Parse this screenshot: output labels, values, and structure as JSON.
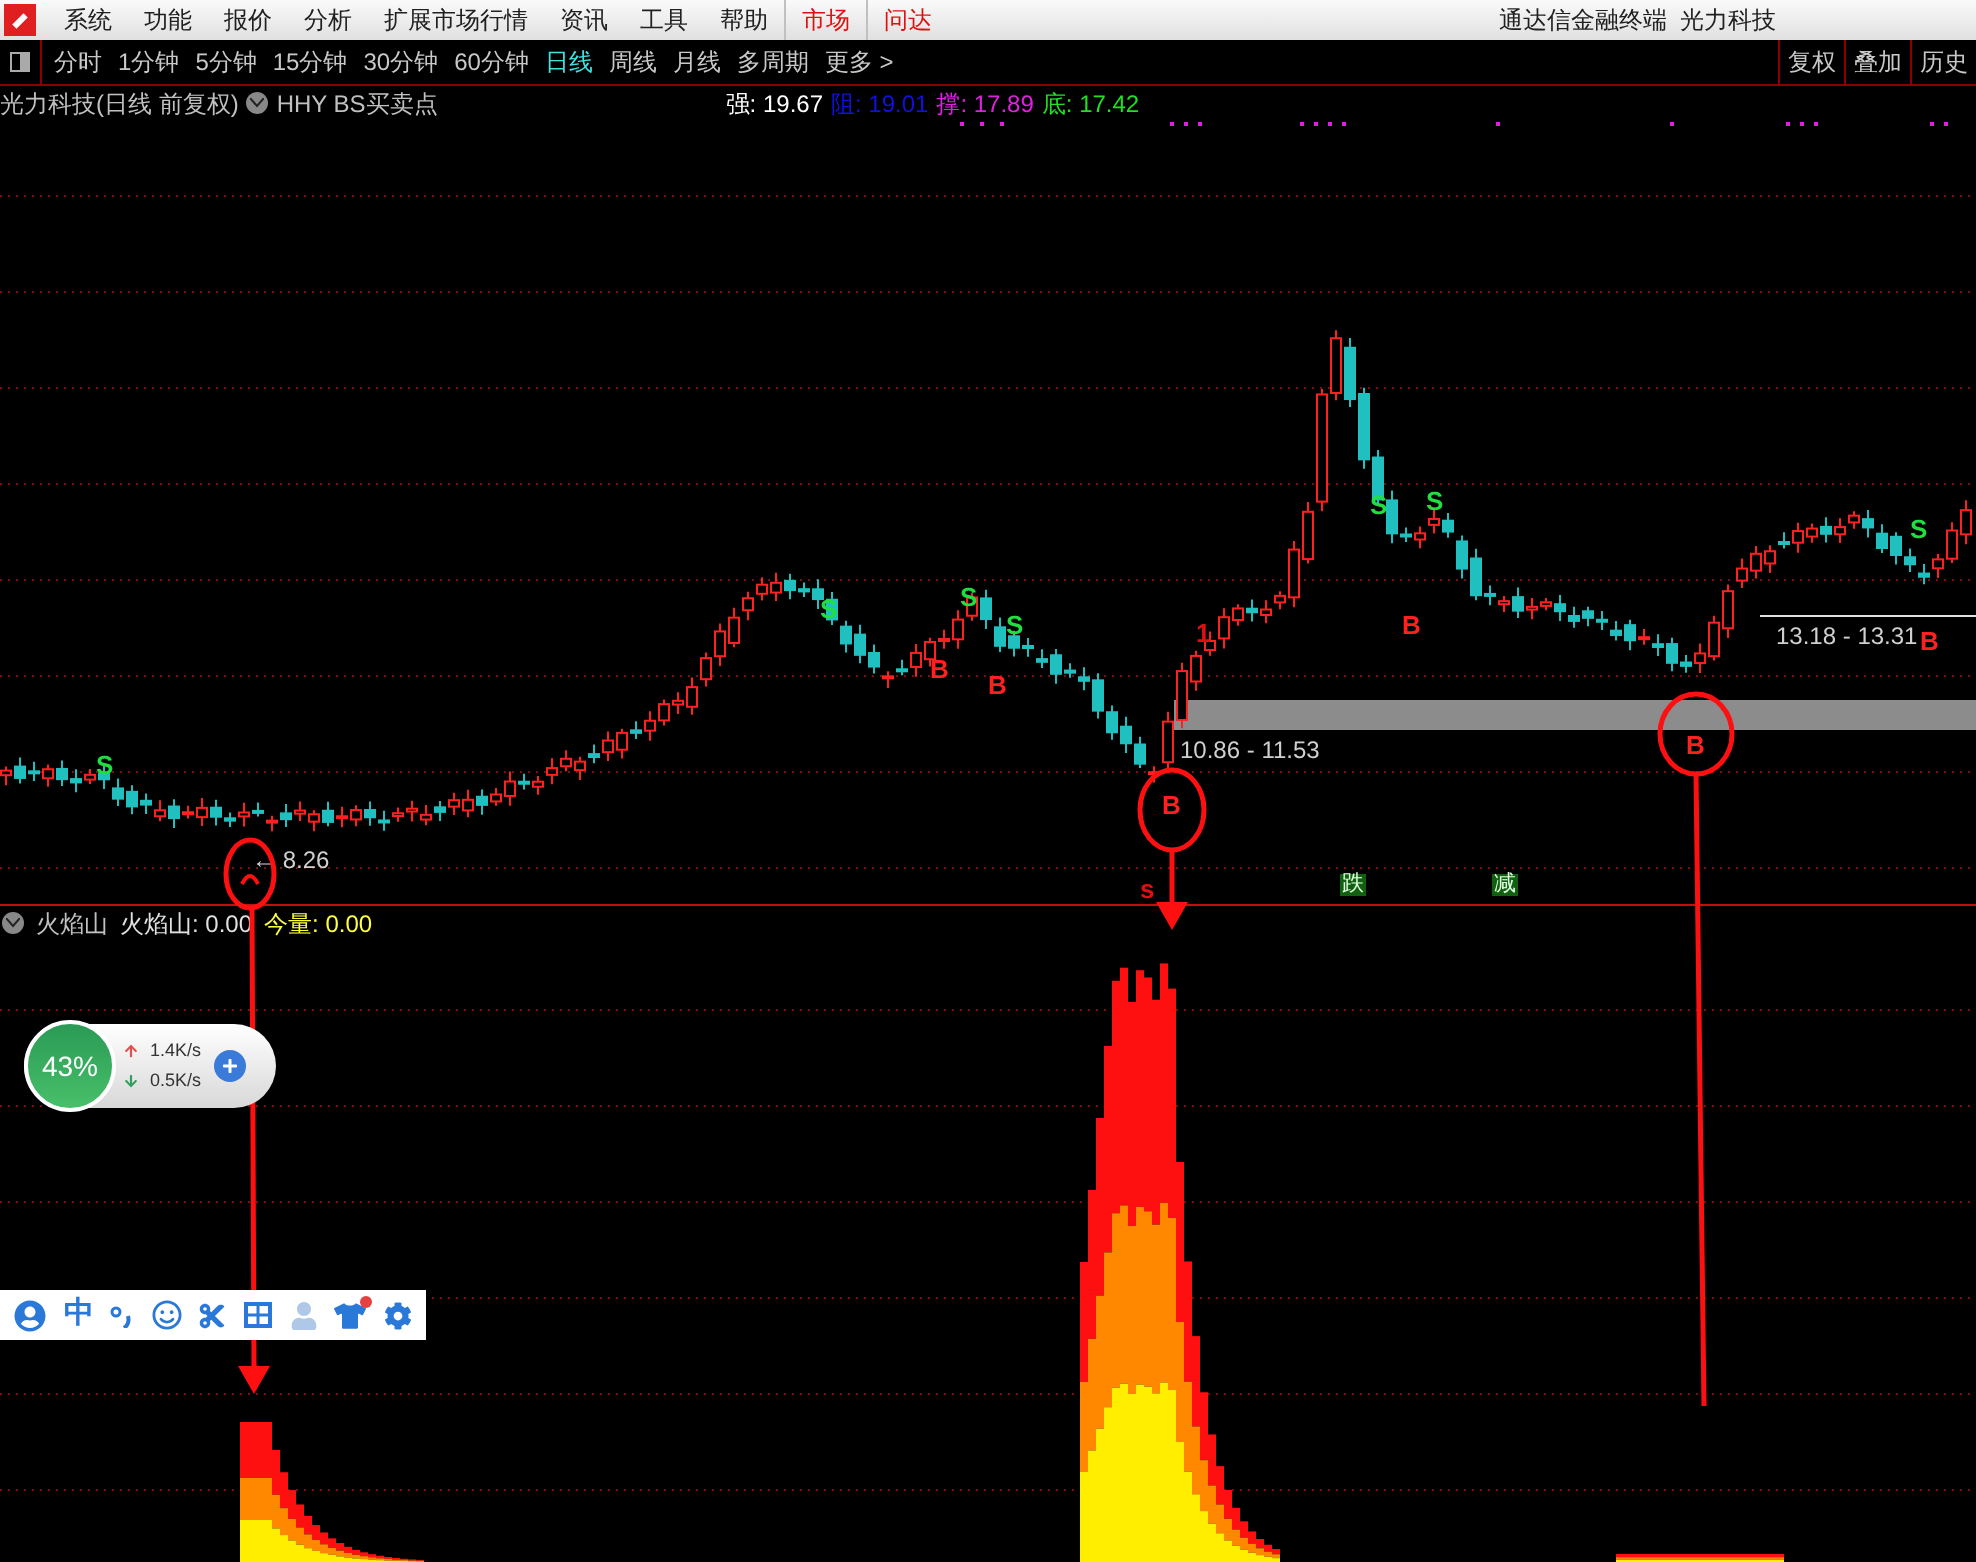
{
  "menu_bar": {
    "items": [
      {
        "label": "系统",
        "highlighted": false
      },
      {
        "label": "功能",
        "highlighted": false
      },
      {
        "label": "报价",
        "highlighted": false
      },
      {
        "label": "分析",
        "highlighted": false
      },
      {
        "label": "扩展市场行情",
        "highlighted": false
      },
      {
        "label": "资讯",
        "highlighted": false
      },
      {
        "label": "工具",
        "highlighted": false
      },
      {
        "label": "帮助",
        "highlighted": false
      },
      {
        "label": "市场",
        "highlighted": true
      },
      {
        "label": "问达",
        "highlighted": true
      }
    ],
    "title": "通达信金融终端  光力科技"
  },
  "period_tabs": [
    {
      "label": "分时",
      "selected": false
    },
    {
      "label": "1分钟",
      "selected": false
    },
    {
      "label": "5分钟",
      "selected": false
    },
    {
      "label": "15分钟",
      "selected": false
    },
    {
      "label": "30分钟",
      "selected": false
    },
    {
      "label": "60分钟",
      "selected": false
    },
    {
      "label": "日线",
      "selected": true
    },
    {
      "label": "周线",
      "selected": false
    },
    {
      "label": "月线",
      "selected": false
    },
    {
      "label": "多周期",
      "selected": false
    },
    {
      "label": "更多 >",
      "selected": false
    }
  ],
  "right_buttons": [
    "复权",
    "叠加",
    "历史"
  ],
  "chart_header": {
    "security": "光力科技(日线 前复权)",
    "indicator": "HHY BS买卖点",
    "readings": [
      {
        "text": "强: 19.67",
        "color": "#ffffff"
      },
      {
        "text": "阻: 19.01",
        "color": "#1010e0"
      },
      {
        "text": "撑: 17.89",
        "color": "#e020e0"
      },
      {
        "text": "底: 17.42",
        "color": "#20e020"
      }
    ]
  },
  "chart_markers": [
    {
      "text": "S",
      "kind": "sell"
    },
    {
      "text": "S",
      "kind": "sell"
    },
    {
      "text": "B",
      "kind": "buy"
    },
    {
      "text": "S",
      "kind": "sell"
    },
    {
      "text": "S",
      "kind": "sell"
    },
    {
      "text": "B",
      "kind": "buy"
    },
    {
      "text": "B",
      "kind": "buy"
    },
    {
      "text": "1",
      "kind": "note"
    },
    {
      "text": "S",
      "kind": "sell"
    },
    {
      "text": "S",
      "kind": "sell"
    },
    {
      "text": "B",
      "kind": "buy"
    },
    {
      "text": "B",
      "kind": "buy"
    },
    {
      "text": "S",
      "kind": "sell"
    },
    {
      "text": "B",
      "kind": "buy"
    },
    {
      "text": "s",
      "kind": "note"
    }
  ],
  "price_labels": [
    "← 8.26",
    "10.86 - 11.53",
    "13.18 - 13.31"
  ],
  "tags": [
    "跌",
    "减"
  ],
  "indicator_header": {
    "name": "火焰山",
    "readings": [
      {
        "text": "火焰山: 0.00",
        "color": "#e0e0e0"
      },
      {
        "text": "今量: 0.00",
        "color": "#ffff40"
      }
    ]
  },
  "network_widget": {
    "percent": "43%",
    "upload": "1.4K/s",
    "download": "0.5K/s"
  },
  "ime_toolbar": {
    "mode": "中"
  }
}
